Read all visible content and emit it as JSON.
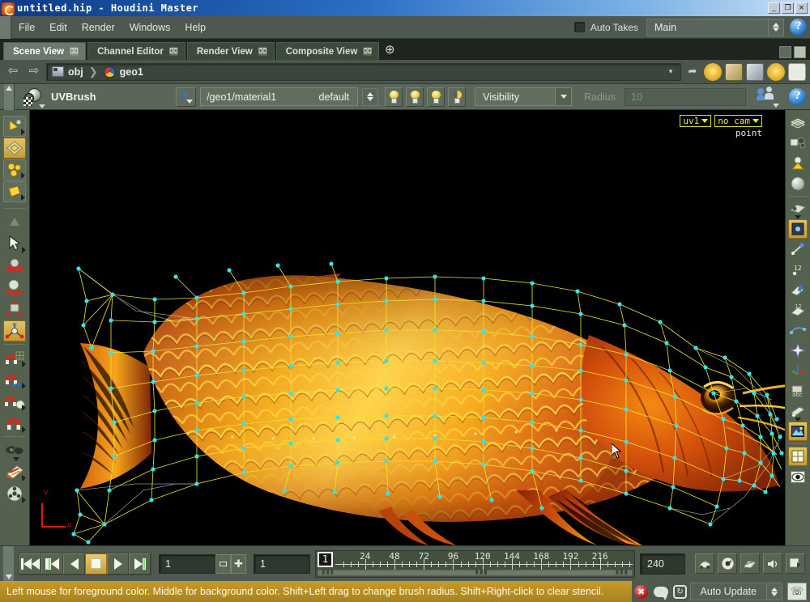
{
  "window": {
    "title": "untitled.hip - Houdini Master",
    "icon": "houdini-logo-icon",
    "minimize": "_",
    "maximize": "❐",
    "close": "×"
  },
  "menubar": {
    "items": [
      "File",
      "Edit",
      "Render",
      "Windows",
      "Help"
    ],
    "auto_takes_label": "Auto Takes",
    "take_selected": "Main",
    "help_label": "?"
  },
  "tabs": {
    "items": [
      {
        "label": "Scene View",
        "active": true,
        "close": "⌧"
      },
      {
        "label": "Channel Editor",
        "active": false,
        "close": "⌧"
      },
      {
        "label": "Render View",
        "active": false,
        "close": "⌧"
      },
      {
        "label": "Composite View",
        "active": false,
        "close": "⌧"
      }
    ],
    "add_label": "⊕"
  },
  "pathbar": {
    "back": "⇦",
    "forward": "⇨",
    "crumbs": [
      {
        "label": "obj",
        "icon": "network-obj-icon"
      },
      {
        "label": "geo1",
        "icon": "geometry-node-icon"
      }
    ],
    "separator": "❯",
    "spin": "▾",
    "pin": "➦"
  },
  "toolbar": {
    "tool_name": "UVBrush",
    "tool_icon": "uvbrush-icon",
    "node_picker_icon": "node-picker-icon",
    "material_path": "/geo1/material1",
    "material_default": "default",
    "light_buttons": [
      "light-full-icon",
      "light-key-icon",
      "light-fill-icon",
      "light-half-icon"
    ],
    "visibility_label": "Visibility",
    "radius_label": "Radius",
    "radius_value": "10",
    "person_icon": "select-person-icon",
    "help_label": "?"
  },
  "viewport": {
    "uv_set": "uv1",
    "camera": "no cam",
    "component_mode": "point",
    "axis_u": "u",
    "axis_v": "v",
    "subject": "arowana-fish-uv-mesh",
    "wire_color": "#f2e62a",
    "point_color": "#2ee6f0",
    "background": "#000000"
  },
  "left_toolbar": {
    "items": [
      {
        "name": "handle-tool",
        "icon": "yellow-cone-icon"
      },
      {
        "name": "uv-edit-tool",
        "icon": "yellow-diamond-icon",
        "selected": true
      },
      {
        "name": "uv-pelt-tool",
        "icon": "yellow-blobs-icon"
      },
      {
        "name": "uv-flatten-tool",
        "icon": "yellow-quad-icon"
      },
      {
        "name": "view-tool",
        "icon": "grey-triangle-icon"
      },
      {
        "name": "select-tool",
        "icon": "arrow-cursor-icon"
      },
      {
        "name": "move-tool",
        "icon": "red-move-icon"
      },
      {
        "name": "rotate-tool",
        "icon": "red-rotate-icon"
      },
      {
        "name": "scale-tool",
        "icon": "red-scale-icon"
      },
      {
        "name": "transform-tool",
        "icon": "orange-axis-icon",
        "selected": true
      },
      {
        "name": "snap-grid-tool",
        "icon": "red-magnet-grid-icon"
      },
      {
        "name": "snap-curve-tool",
        "icon": "red-magnet-curve-icon"
      },
      {
        "name": "snap-point-tool",
        "icon": "red-magnet-point-icon"
      },
      {
        "name": "snap-multi-tool",
        "icon": "red-magnet-multi-icon"
      },
      {
        "name": "paint-tool",
        "icon": "dark-paint-icon"
      },
      {
        "name": "texture-tool",
        "icon": "palette-icon"
      },
      {
        "name": "film-tool",
        "icon": "film-reel-icon"
      }
    ]
  },
  "right_toolbar": {
    "items": [
      {
        "name": "shading-mode",
        "icon": "disc-shade-icon"
      },
      {
        "name": "lighting-mode",
        "icon": "lighting-icon"
      },
      {
        "name": "headlight-mode",
        "icon": "headlight-icon"
      },
      {
        "name": "smooth-shade",
        "icon": "sphere-icon"
      },
      {
        "name": "display-options",
        "icon": "display-flag-icon"
      },
      {
        "name": "point-display",
        "icon": "point-display-icon",
        "selected": true
      },
      {
        "name": "point-normals",
        "icon": "normal-vector-icon"
      },
      {
        "name": "point-numbers",
        "icon": "point-number-icon"
      },
      {
        "name": "prim-display",
        "icon": "prim-paint-icon"
      },
      {
        "name": "prim-numbers",
        "icon": "prim-number-icon"
      },
      {
        "name": "curve-display",
        "icon": "curve-display-icon"
      },
      {
        "name": "origin-display",
        "icon": "origin-cross-icon"
      },
      {
        "name": "axes-display",
        "icon": "axes-display-icon"
      },
      {
        "name": "text-display",
        "icon": "abc-text-icon"
      },
      {
        "name": "material-display",
        "icon": "material-flag-icon"
      },
      {
        "name": "texture-display",
        "icon": "texture-image-icon",
        "selected": true
      },
      {
        "name": "grid-display",
        "icon": "uv-grid-icon",
        "selected": true
      },
      {
        "name": "visibility-eye",
        "icon": "eye-icon"
      }
    ]
  },
  "timeline": {
    "transport": [
      {
        "name": "jump-to-start",
        "icon": "skip-start-icon"
      },
      {
        "name": "previous-keyframe",
        "icon": "prev-key-icon"
      },
      {
        "name": "play-reverse",
        "icon": "play-reverse-icon"
      },
      {
        "name": "stop",
        "icon": "stop-icon",
        "active": true
      },
      {
        "name": "play-forward",
        "icon": "play-forward-icon"
      },
      {
        "name": "next-keyframe",
        "icon": "next-key-icon"
      }
    ],
    "current_frame": "1",
    "frame_value": "1",
    "end_frame": "240",
    "range_start": 1,
    "range_end": 240,
    "tick_labels": [
      "24",
      "48",
      "72",
      "96",
      "120",
      "144",
      "168",
      "192",
      "216"
    ],
    "playback_buttons": [
      {
        "name": "playbar-options",
        "icon": "playbar-icon"
      },
      {
        "name": "realtime-toggle",
        "icon": "realtime-icon"
      },
      {
        "name": "audio-panel",
        "icon": "audio-panel-icon"
      },
      {
        "name": "audio-toggle",
        "icon": "speaker-icon"
      },
      {
        "name": "key-options",
        "icon": "key-options-icon"
      }
    ]
  },
  "statusbar": {
    "message": "Left mouse for foreground color. Middle for background color. Shift+Left drag to change brush radius. Shift+Right-click to clear stencil.",
    "stop_icon": "stop-error-icon",
    "cloud_icon": "comment-icon",
    "recycle_icon": "recycle-icon",
    "auto_update_label": "Auto Update",
    "phone_icon": "render-phone-icon"
  }
}
